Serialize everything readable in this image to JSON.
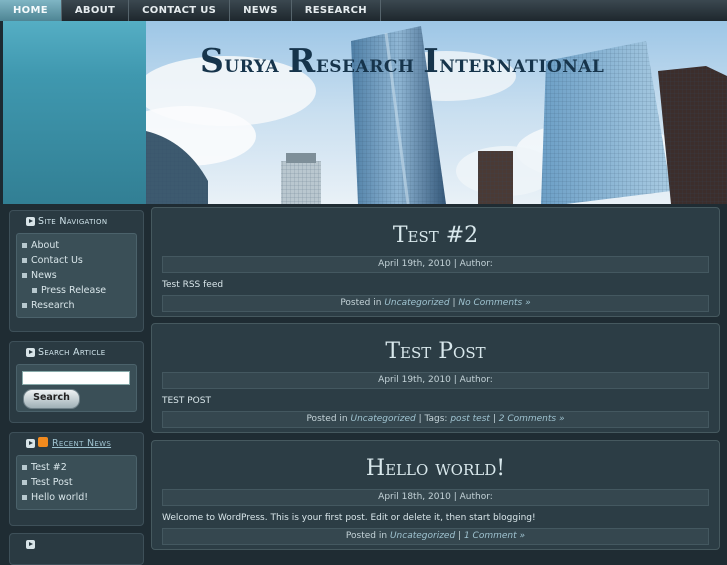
{
  "nav": {
    "items": [
      {
        "label": "HOME"
      },
      {
        "label": "ABOUT"
      },
      {
        "label": "CONTACT US"
      },
      {
        "label": "NEWS"
      },
      {
        "label": "RESEARCH"
      }
    ]
  },
  "header": {
    "title_parts": [
      {
        "cap": "S",
        "rest": "urya "
      },
      {
        "cap": "R",
        "rest": "esearch "
      },
      {
        "cap": "I",
        "rest": "nternational"
      }
    ]
  },
  "sidebar": {
    "site_nav": {
      "title": "Site Navigation",
      "items": [
        {
          "label": "About"
        },
        {
          "label": "Contact Us"
        },
        {
          "label": "News"
        },
        {
          "label": "Press Release"
        },
        {
          "label": "Research"
        }
      ]
    },
    "search": {
      "title": "Search Article",
      "input_value": "",
      "button_label": "Search"
    },
    "recent": {
      "title": "Recent News",
      "items": [
        {
          "label": "Test #2"
        },
        {
          "label": "Test Post"
        },
        {
          "label": "Hello world!"
        }
      ]
    }
  },
  "posts": [
    {
      "title": "Test #2",
      "meta": "April 19th, 2010 | Author:",
      "body": "Test RSS feed",
      "posted_in": "Posted in",
      "category": "Uncategorized",
      "separator": "|",
      "tags_label": "",
      "tags": "",
      "comments": "No Comments »"
    },
    {
      "title": "Test Post",
      "meta": "April 19th, 2010 | Author:",
      "body": "TEST POST",
      "posted_in": "Posted in",
      "category": "Uncategorized",
      "separator": "|",
      "tags_label": "Tags:",
      "tags": "post test",
      "comments": "2 Comments »"
    },
    {
      "title": "Hello world!",
      "meta": "April 18th, 2010 | Author:",
      "body": "Welcome to WordPress. This is your first post. Edit or delete it, then start blogging!",
      "posted_in": "Posted in",
      "category": "Uncategorized",
      "separator": "|",
      "tags_label": "",
      "tags": "",
      "comments": "1 Comment »"
    }
  ]
}
